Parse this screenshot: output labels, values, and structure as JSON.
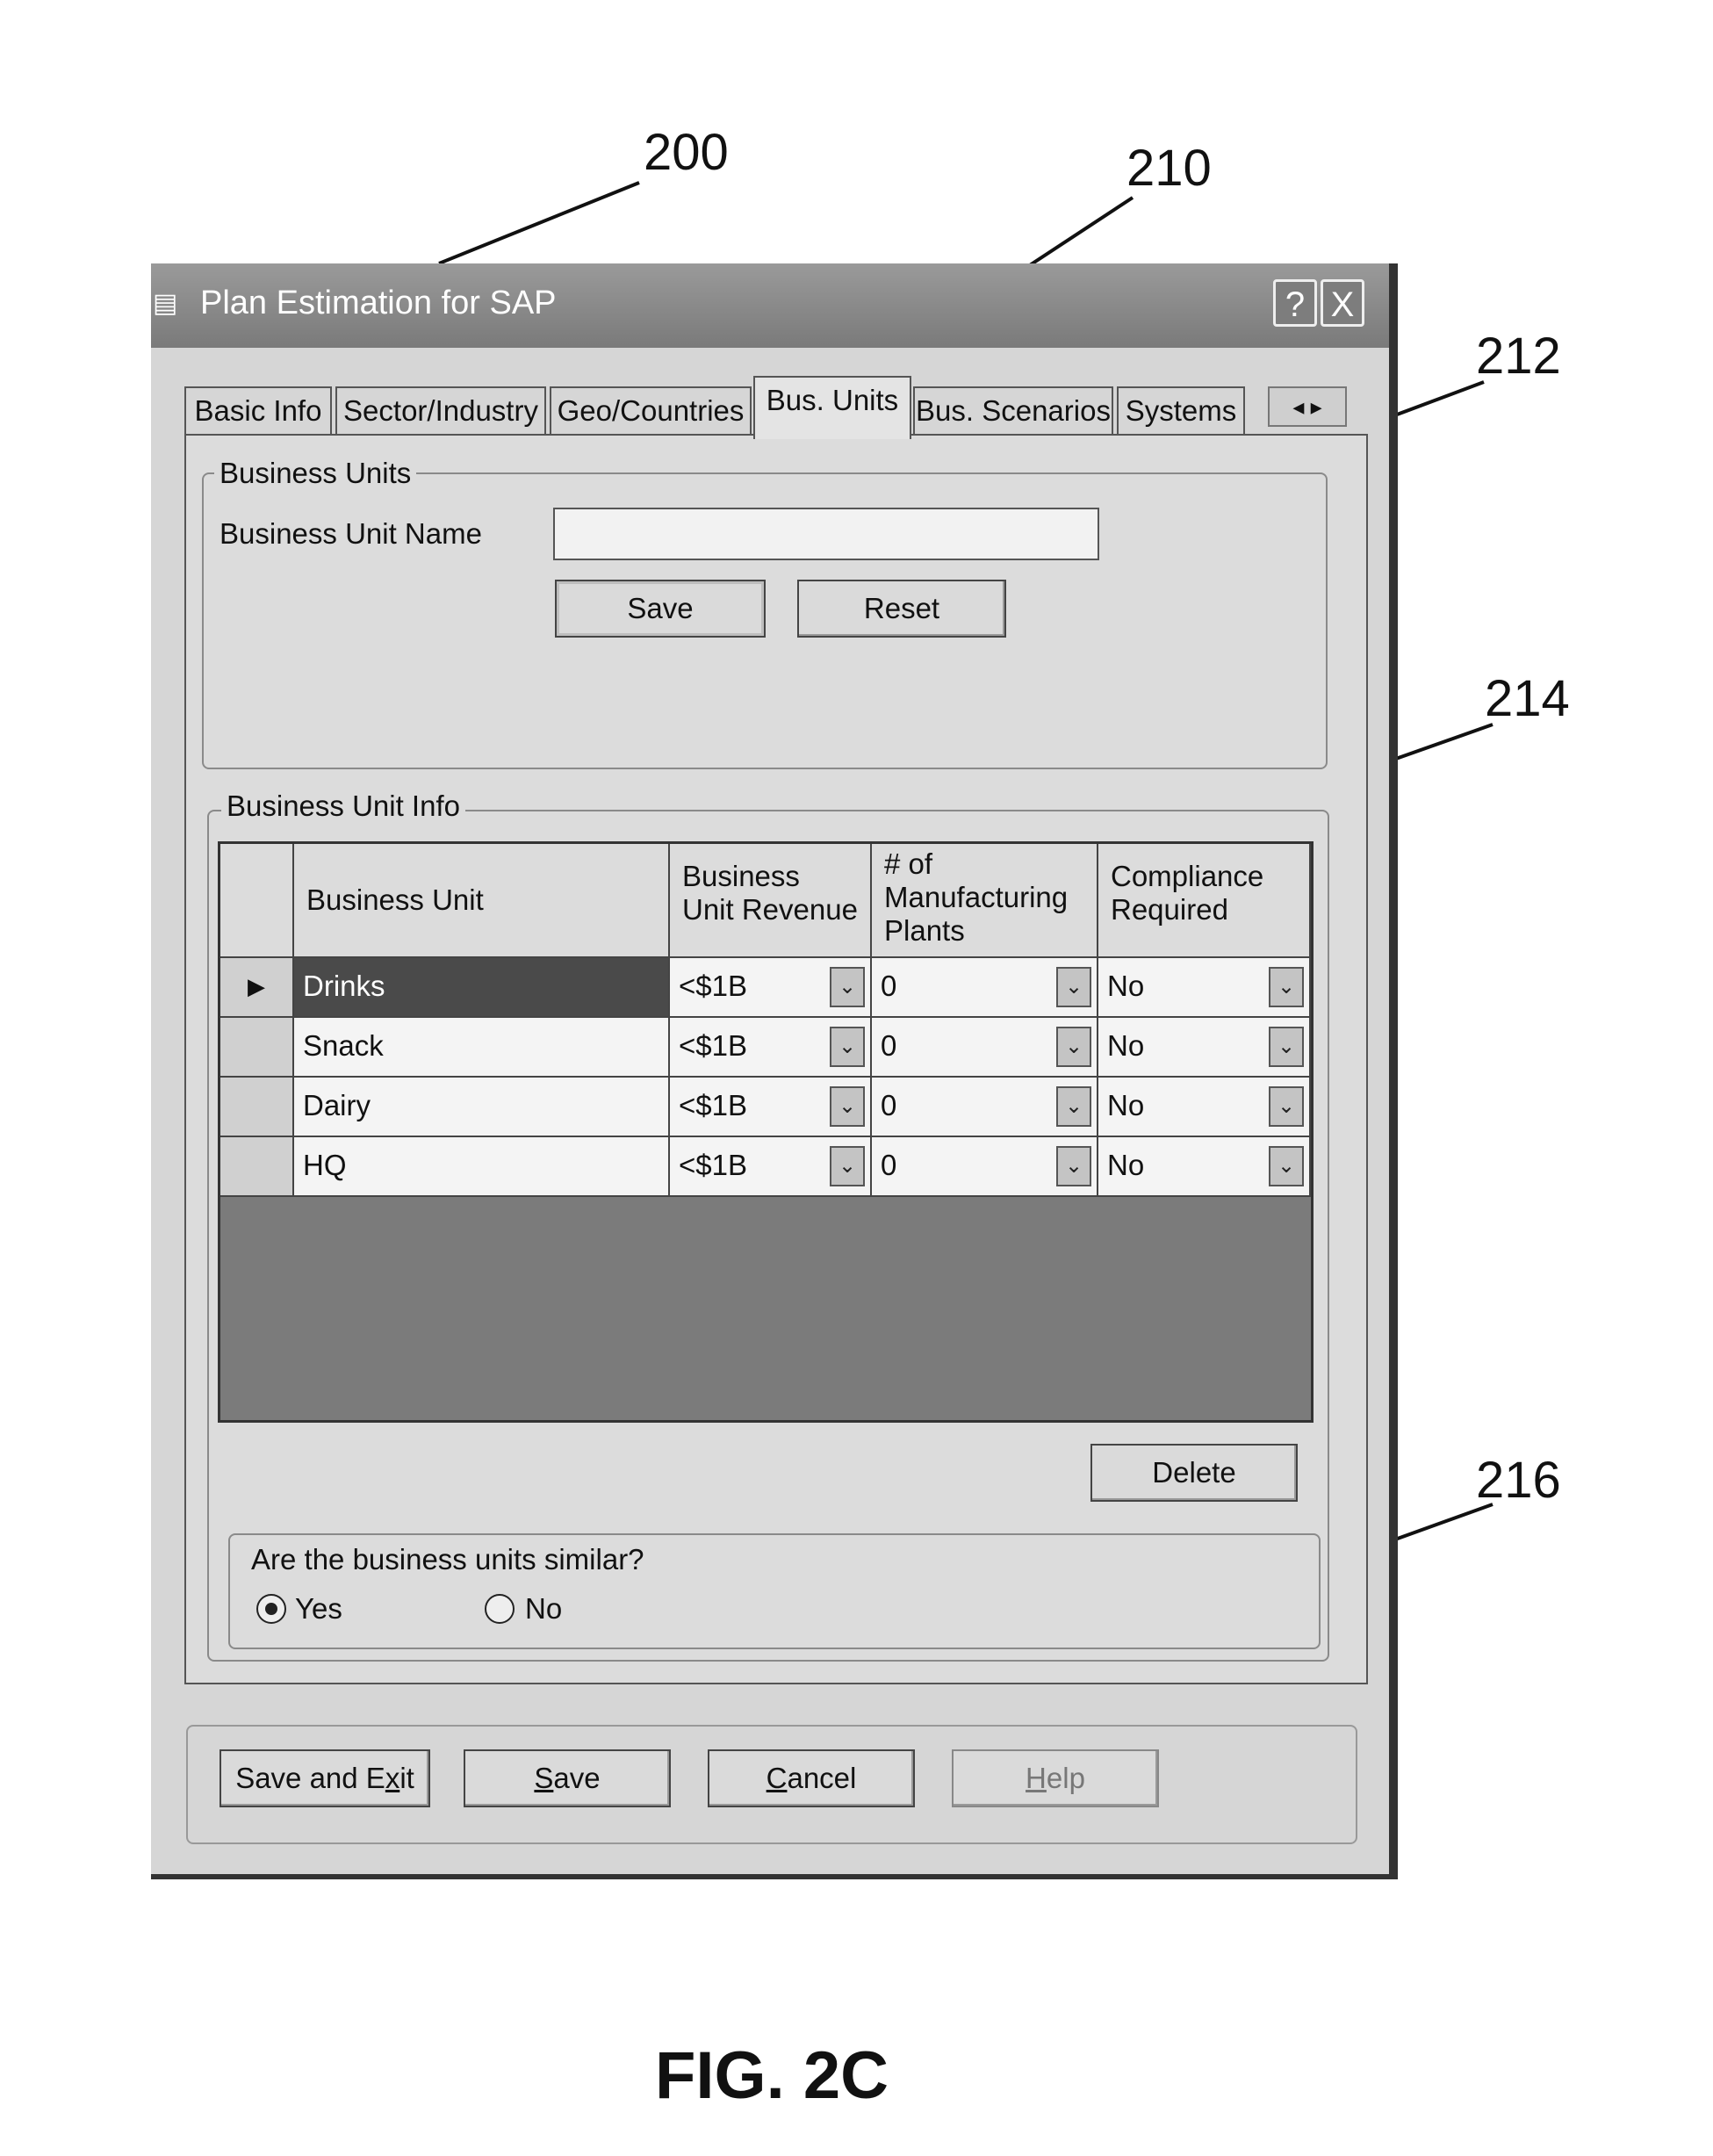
{
  "figure": {
    "caption": "FIG. 2C",
    "ref_window": "200",
    "ref_tab": "210",
    "ref_name_field": "212",
    "ref_grid": "214",
    "ref_similar_group": "216"
  },
  "window": {
    "title": "Plan Estimation for SAP",
    "help_button": "?",
    "close_button": "X"
  },
  "tabs": [
    {
      "label": "Basic Info"
    },
    {
      "label": "Sector/Industry"
    },
    {
      "label": "Geo/Countries"
    },
    {
      "label": "Bus. Units",
      "active": true
    },
    {
      "label": "Bus. Scenarios"
    },
    {
      "label": "Systems"
    }
  ],
  "tab_scroll": {
    "left": "◂",
    "right": "▸"
  },
  "business_units": {
    "legend": "Business Units",
    "name_label": "Business Unit Name",
    "name_value": "",
    "save_label": "Save",
    "reset_label": "Reset"
  },
  "business_unit_info": {
    "legend": "Business Unit Info",
    "columns": [
      "Business Unit",
      "Business Unit Revenue",
      "# of Manufacturing Plants",
      "Compliance Required"
    ],
    "rows": [
      {
        "unit": "Drinks",
        "revenue": "<$1B",
        "plants": "0",
        "compliance": "No",
        "selected": true
      },
      {
        "unit": "Snack",
        "revenue": "<$1B",
        "plants": "0",
        "compliance": "No"
      },
      {
        "unit": "Dairy",
        "revenue": "<$1B",
        "plants": "0",
        "compliance": "No"
      },
      {
        "unit": "HQ",
        "revenue": "<$1B",
        "plants": "0",
        "compliance": "No"
      }
    ],
    "current_row_marker": "▶",
    "delete_label": "Delete"
  },
  "similarity": {
    "question": "Are the business units similar?",
    "yes_label": "Yes",
    "no_label": "No",
    "selected": "Yes"
  },
  "footer": {
    "save_exit_pre": "Save and E",
    "save_exit_u": "x",
    "save_exit_post": "it",
    "save_u": "S",
    "save_post": "ave",
    "cancel_u": "C",
    "cancel_post": "ancel",
    "help_u": "H",
    "help_post": "elp"
  },
  "dropdown_glyph": "⌄"
}
